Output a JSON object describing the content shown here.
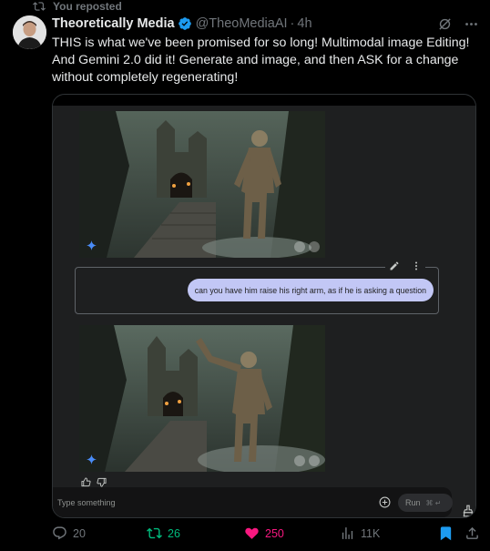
{
  "repost": {
    "label": "You reposted"
  },
  "tweet": {
    "author": "Theoretically Media",
    "handle": "@TheoMediaAI",
    "separator": "·",
    "time": "4h",
    "text": "THIS is what we've been promised for so long! Multimodal image Editing! And Gemini 2.0 did it! Generate and image, and then ASK for a change without completely regenerating!"
  },
  "embed": {
    "prompt_text": "can you have him raise his right arm, as if he is asking a question",
    "input_placeholder": "Type something",
    "run_label": "Run",
    "run_shortcut": "⌘ ↵"
  },
  "actions": {
    "replies": "20",
    "reposts": "26",
    "likes": "250",
    "views": "11K"
  },
  "colors": {
    "background": "#000000",
    "text": "#e7e9ea",
    "muted": "#71767b",
    "verified": "#1d9bf0",
    "repost_active": "#00ba7c",
    "like_active": "#f91880",
    "bookmark_active": "#1d9bf0",
    "prompt_bubble": "#c2c7f5",
    "panel": "#1e1f20"
  },
  "icons": {
    "repost": "repost-icon",
    "verified": "verified-badge-icon",
    "grok": "grok-icon",
    "more": "more-icon",
    "edit": "pencil-icon",
    "sparkle": "gemini-sparkle-icon",
    "download": "download-icon",
    "fullscreen": "fullscreen-icon",
    "thumbs_up": "thumbs-up-icon",
    "thumbs_down": "thumbs-down-icon",
    "add": "add-circle-icon",
    "brush": "brush-icon",
    "reply": "reply-icon",
    "like": "heart-icon",
    "views": "views-icon",
    "bookmark": "bookmark-icon",
    "share": "share-icon"
  }
}
